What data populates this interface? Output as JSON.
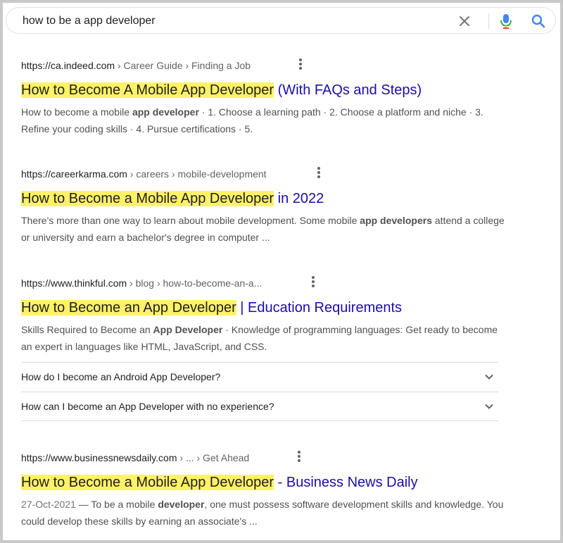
{
  "search": {
    "query": "how to be a app developer"
  },
  "results": [
    {
      "url": "https://ca.indeed.com",
      "breadcrumb": " › Career Guide › Finding a Job",
      "title_highlight": "How to Become A Mobile App Developer",
      "title_rest": " (With FAQs and Steps)",
      "snippet": [
        {
          "t": "How to become a mobile "
        },
        {
          "b": "app developer"
        },
        {
          "t": " · 1. Choose a learning path · 2. Choose a platform and niche · 3. Refine your coding skills · 4. Pursue certifications · 5."
        }
      ]
    },
    {
      "url": "https://careerkarma.com",
      "breadcrumb": " › careers › mobile-development",
      "title_highlight": "How to Become a Mobile App Developer",
      "title_rest": " in 2022",
      "snippet": [
        {
          "t": "There's more than one way to learn about mobile development. Some mobile "
        },
        {
          "b": "app developers"
        },
        {
          "t": " attend a college or university and earn a bachelor's degree in computer ..."
        }
      ]
    },
    {
      "url": "https://www.thinkful.com",
      "breadcrumb": " › blog › how-to-become-an-a...",
      "title_highlight": "How to Become an App Developer",
      "title_rest": " | Education Requirements",
      "snippet": [
        {
          "t": "Skills Required to Become an "
        },
        {
          "b": "App Developer"
        },
        {
          "t": " · Knowledge of programming languages: Get ready to become an expert in languages like HTML, JavaScript, and CSS."
        }
      ]
    },
    {
      "url": "https://www.businessnewsdaily.com",
      "breadcrumb": " › ... › Get Ahead",
      "title_highlight": "How to Become a Mobile App Developer",
      "title_rest": " - Business News Daily",
      "date": "27-Oct-2021",
      "snippet": [
        {
          "t": " — To be a mobile "
        },
        {
          "b": "developer"
        },
        {
          "t": ", one must possess software development skills and knowledge. You could develop these skills by earning an associate's ..."
        }
      ]
    }
  ],
  "related_questions": [
    "How do I become an Android App Developer?",
    "How can I become an App Developer with no experience?"
  ],
  "colors": {
    "link": "#1a0dab",
    "highlight": "#fff266",
    "snippet": "#4d5156"
  },
  "icons": [
    "close-icon",
    "microphone-icon",
    "search-icon",
    "more-vert-icon",
    "chevron-down-icon"
  ]
}
